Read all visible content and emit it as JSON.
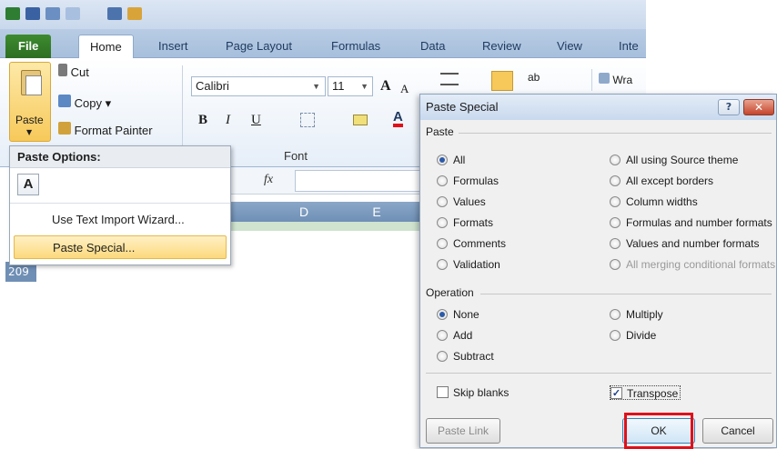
{
  "ribbon": {
    "tabs": [
      "File",
      "Home",
      "Insert",
      "Page Layout",
      "Formulas",
      "Data",
      "Review",
      "View",
      "Inte"
    ],
    "clipboard": {
      "paste": "Paste",
      "cut": "Cut",
      "copy": "Copy ▾",
      "format_painter": "Format Painter"
    },
    "font": {
      "name": "Calibri",
      "size": "11",
      "group_label": "Font"
    },
    "wrap": "Wra"
  },
  "paste_menu": {
    "header": "Paste Options:",
    "options_icon": "A",
    "item_text_import": "Use Text Import Wizard...",
    "item_paste_special": "Paste Special..."
  },
  "sheet": {
    "fx": "fx",
    "columns": [
      "D",
      "E"
    ],
    "row_number": "209"
  },
  "dialog": {
    "title": "Paste Special",
    "help": "?",
    "close": "✕",
    "paste_group": "Paste",
    "paste_left": [
      "All",
      "Formulas",
      "Values",
      "Formats",
      "Comments",
      "Validation"
    ],
    "paste_right": [
      "All using Source theme",
      "All except borders",
      "Column widths",
      "Formulas and number formats",
      "Values and number formats",
      "All merging conditional formats"
    ],
    "paste_selected": "All",
    "operation_group": "Operation",
    "operation_left": [
      "None",
      "Add",
      "Subtract"
    ],
    "operation_right": [
      "Multiply",
      "Divide"
    ],
    "operation_selected": "None",
    "skip_blanks": "Skip blanks",
    "transpose": "Transpose",
    "transpose_checked": true,
    "paste_link": "Paste Link",
    "ok": "OK",
    "cancel": "Cancel"
  },
  "colors": {
    "highlight": "#e0101a",
    "file_tab": "#2d6e22",
    "menu_selected": "#fcd97c"
  }
}
